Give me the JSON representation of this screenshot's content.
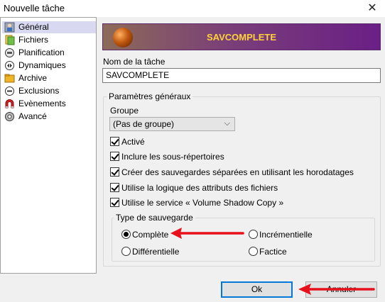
{
  "window": {
    "title": "Nouvelle tâche",
    "close_glyph": "✕"
  },
  "sidebar": {
    "items": [
      {
        "label": "Général",
        "icon": "general-icon"
      },
      {
        "label": "Fichiers",
        "icon": "files-icon"
      },
      {
        "label": "Planification",
        "icon": "schedule-icon"
      },
      {
        "label": "Dynamiques",
        "icon": "dynamics-icon"
      },
      {
        "label": "Archive",
        "icon": "archive-icon"
      },
      {
        "label": "Exclusions",
        "icon": "exclusions-icon"
      },
      {
        "label": "Evènements",
        "icon": "events-icon"
      },
      {
        "label": "Avancé",
        "icon": "advanced-icon"
      }
    ],
    "selected": "Général"
  },
  "banner": {
    "title": "SAVCOMPLETE",
    "title_color": "#ffd23a"
  },
  "task": {
    "name_label": "Nom de la tâche",
    "name_value": "SAVCOMPLETE"
  },
  "general_params": {
    "legend": "Paramètres généraux",
    "group_label": "Groupe",
    "group_value": "(Pas de groupe)",
    "checkboxes": [
      {
        "label": "Activé",
        "checked": true
      },
      {
        "label": "Inclure les sous-répertoires",
        "checked": true
      },
      {
        "label": "Créer des sauvegardes séparées en utilisant les horodatages",
        "checked": true
      },
      {
        "label": "Utilise la logique des attributs des fichiers",
        "checked": true
      },
      {
        "label": "Utilise le service « Volume Shadow Copy »",
        "checked": true
      }
    ]
  },
  "backup_type": {
    "legend": "Type de sauvegarde",
    "options": [
      {
        "label": "Complète",
        "checked": true
      },
      {
        "label": "Incrémentielle",
        "checked": false
      },
      {
        "label": "Différentielle",
        "checked": false
      },
      {
        "label": "Factice",
        "checked": false
      }
    ]
  },
  "buttons": {
    "ok": "Ok",
    "cancel": "Annuler"
  },
  "colors": {
    "annotation_arrow": "#e8101a",
    "default_button_border": "#0078d7"
  }
}
